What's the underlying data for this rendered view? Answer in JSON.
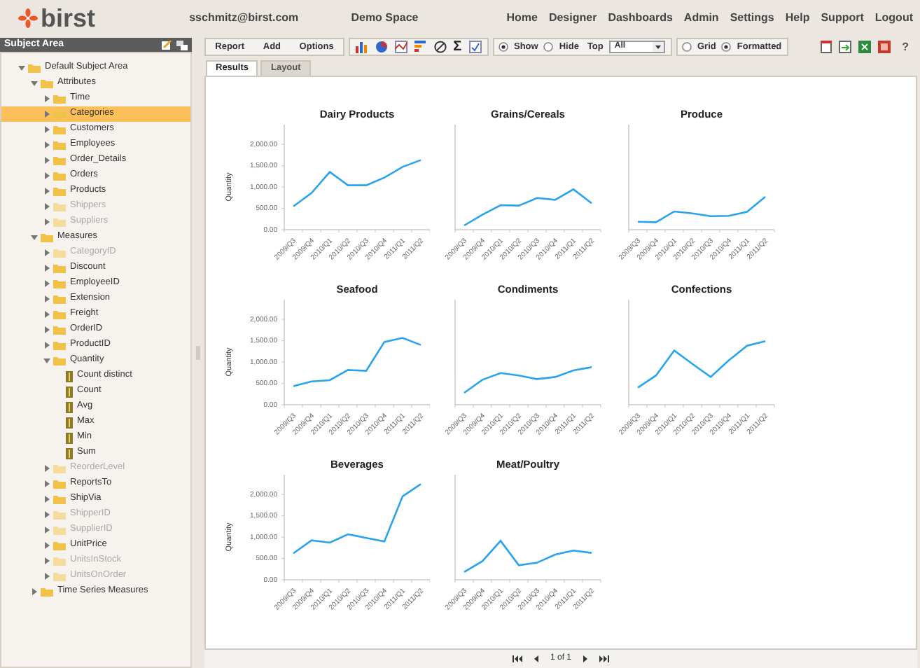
{
  "header": {
    "logo": "birst",
    "user": "sschmitz@birst.com",
    "space": "Demo Space",
    "nav": [
      "Home",
      "Designer",
      "Dashboards",
      "Admin",
      "Settings",
      "Help",
      "Support",
      "Logout"
    ]
  },
  "sidebar": {
    "title": "Subject Area",
    "tree": [
      {
        "label": "Default Subject Area",
        "kind": "folder",
        "expanded": true,
        "selected": false,
        "disabled": false,
        "children": [
          {
            "label": "Attributes",
            "kind": "folder",
            "expanded": true,
            "selected": false,
            "disabled": false,
            "children": [
              {
                "label": "Time",
                "kind": "folder",
                "expanded": false,
                "selected": false,
                "disabled": false
              },
              {
                "label": "Categories",
                "kind": "folder",
                "expanded": false,
                "selected": true,
                "disabled": false
              },
              {
                "label": "Customers",
                "kind": "folder",
                "expanded": false,
                "selected": false,
                "disabled": false
              },
              {
                "label": "Employees",
                "kind": "folder",
                "expanded": false,
                "selected": false,
                "disabled": false
              },
              {
                "label": "Order_Details",
                "kind": "folder",
                "expanded": false,
                "selected": false,
                "disabled": false
              },
              {
                "label": "Orders",
                "kind": "folder",
                "expanded": false,
                "selected": false,
                "disabled": false
              },
              {
                "label": "Products",
                "kind": "folder",
                "expanded": false,
                "selected": false,
                "disabled": false
              },
              {
                "label": "Shippers",
                "kind": "folder",
                "expanded": false,
                "selected": false,
                "disabled": true
              },
              {
                "label": "Suppliers",
                "kind": "folder",
                "expanded": false,
                "selected": false,
                "disabled": true
              }
            ]
          },
          {
            "label": "Measures",
            "kind": "folder",
            "expanded": true,
            "selected": false,
            "disabled": false,
            "children": [
              {
                "label": "CategoryID",
                "kind": "folder",
                "expanded": false,
                "selected": false,
                "disabled": true
              },
              {
                "label": "Discount",
                "kind": "folder",
                "expanded": false,
                "selected": false,
                "disabled": false
              },
              {
                "label": "EmployeeID",
                "kind": "folder",
                "expanded": false,
                "selected": false,
                "disabled": false
              },
              {
                "label": "Extension",
                "kind": "folder",
                "expanded": false,
                "selected": false,
                "disabled": false
              },
              {
                "label": "Freight",
                "kind": "folder",
                "expanded": false,
                "selected": false,
                "disabled": false
              },
              {
                "label": "OrderID",
                "kind": "folder",
                "expanded": false,
                "selected": false,
                "disabled": false
              },
              {
                "label": "ProductID",
                "kind": "folder",
                "expanded": false,
                "selected": false,
                "disabled": false
              },
              {
                "label": "Quantity",
                "kind": "folder",
                "expanded": true,
                "selected": false,
                "disabled": false,
                "children": [
                  {
                    "label": "Count distinct",
                    "kind": "measure",
                    "selected": false,
                    "disabled": false
                  },
                  {
                    "label": "Count",
                    "kind": "measure",
                    "selected": false,
                    "disabled": false
                  },
                  {
                    "label": "Avg",
                    "kind": "measure",
                    "selected": false,
                    "disabled": false
                  },
                  {
                    "label": "Max",
                    "kind": "measure",
                    "selected": false,
                    "disabled": false
                  },
                  {
                    "label": "Min",
                    "kind": "measure",
                    "selected": false,
                    "disabled": false
                  },
                  {
                    "label": "Sum",
                    "kind": "measure",
                    "selected": false,
                    "disabled": false
                  }
                ]
              },
              {
                "label": "ReorderLevel",
                "kind": "folder",
                "expanded": false,
                "selected": false,
                "disabled": true
              },
              {
                "label": "ReportsTo",
                "kind": "folder",
                "expanded": false,
                "selected": false,
                "disabled": false
              },
              {
                "label": "ShipVia",
                "kind": "folder",
                "expanded": false,
                "selected": false,
                "disabled": false
              },
              {
                "label": "ShipperID",
                "kind": "folder",
                "expanded": false,
                "selected": false,
                "disabled": true
              },
              {
                "label": "SupplierID",
                "kind": "folder",
                "expanded": false,
                "selected": false,
                "disabled": true
              },
              {
                "label": "UnitPrice",
                "kind": "folder",
                "expanded": false,
                "selected": false,
                "disabled": false
              },
              {
                "label": "UnitsInStock",
                "kind": "folder",
                "expanded": false,
                "selected": false,
                "disabled": true
              },
              {
                "label": "UnitsOnOrder",
                "kind": "folder",
                "expanded": false,
                "selected": false,
                "disabled": true
              }
            ]
          },
          {
            "label": "Time Series Measures",
            "kind": "folder",
            "expanded": false,
            "selected": false,
            "disabled": false
          }
        ]
      }
    ]
  },
  "toolbar": {
    "menus": [
      "Report",
      "Add",
      "Options"
    ],
    "sigma": "Σ",
    "display": [
      {
        "label": "Show",
        "selected": true
      },
      {
        "label": "Hide",
        "selected": false
      }
    ],
    "top_label": "Top",
    "top_value": "All",
    "view": [
      {
        "label": "Grid",
        "selected": false
      },
      {
        "label": "Formatted",
        "selected": true
      }
    ],
    "help": "?"
  },
  "tabs": [
    {
      "label": "Results",
      "selected": true
    },
    {
      "label": "Layout",
      "selected": false
    }
  ],
  "charts": [
    {
      "chart_data": {
        "type": "line",
        "title": "Dairy Products",
        "ylabel": "Quantity",
        "categories": [
          "2009/Q3",
          "2009/Q4",
          "2010/Q1",
          "2010/Q2",
          "2010/Q3",
          "2010/Q4",
          "2011/Q1",
          "2011/Q2"
        ],
        "series": [
          {
            "color": "#2aa3ee",
            "values": [
              543,
              860,
              1350,
              1040,
              1040,
              1220,
              1470,
              1630
            ]
          }
        ],
        "ylim": [
          0,
          2460
        ],
        "yticks": [
          {
            "value": 0,
            "label": "0.00"
          },
          {
            "value": 500,
            "label": "500.00"
          },
          {
            "value": 1000,
            "label": "1,000.00"
          },
          {
            "value": 1500,
            "label": "1,500.00"
          },
          {
            "value": 2000,
            "label": "2,000.00"
          }
        ]
      }
    },
    {
      "chart_data": {
        "type": "line",
        "title": "Grains/Cereals",
        "categories": [
          "2009/Q3",
          "2009/Q4",
          "2010/Q1",
          "2010/Q2",
          "2010/Q3",
          "2010/Q4",
          "2011/Q1",
          "2011/Q2"
        ],
        "series": [
          {
            "color": "#2aa3ee",
            "values": [
              100,
              350,
              575,
              565,
              740,
              700,
              945,
              620
            ]
          }
        ],
        "ylim": [
          0,
          2460
        ]
      }
    },
    {
      "chart_data": {
        "type": "line",
        "title": "Produce",
        "categories": [
          "2009/Q3",
          "2009/Q4",
          "2010/Q1",
          "2010/Q2",
          "2010/Q3",
          "2010/Q4",
          "2011/Q1",
          "2011/Q2"
        ],
        "series": [
          {
            "color": "#2aa3ee",
            "values": [
              185,
              175,
              425,
              380,
              315,
              325,
              415,
              770
            ]
          }
        ],
        "ylim": [
          0,
          2460
        ]
      }
    },
    {
      "chart_data": {
        "type": "line",
        "title": "Seafood",
        "ylabel": "Quantity",
        "categories": [
          "2009/Q3",
          "2009/Q4",
          "2010/Q1",
          "2010/Q2",
          "2010/Q3",
          "2010/Q4",
          "2011/Q1",
          "2011/Q2"
        ],
        "series": [
          {
            "color": "#2aa3ee",
            "values": [
              435,
              545,
              575,
              815,
              795,
              1470,
              1565,
              1400
            ]
          }
        ],
        "ylim": [
          0,
          2460
        ],
        "yticks": [
          {
            "value": 0,
            "label": "0.00"
          },
          {
            "value": 500,
            "label": "500.00"
          },
          {
            "value": 1000,
            "label": "1,000.00"
          },
          {
            "value": 1500,
            "label": "1,500.00"
          },
          {
            "value": 2000,
            "label": "2,000.00"
          }
        ]
      }
    },
    {
      "chart_data": {
        "type": "line",
        "title": "Condiments",
        "categories": [
          "2009/Q3",
          "2009/Q4",
          "2010/Q1",
          "2010/Q2",
          "2010/Q3",
          "2010/Q4",
          "2011/Q1",
          "2011/Q2"
        ],
        "series": [
          {
            "color": "#2aa3ee",
            "values": [
              280,
              585,
              740,
              685,
              600,
              650,
              805,
              880
            ]
          }
        ],
        "ylim": [
          0,
          2460
        ]
      }
    },
    {
      "chart_data": {
        "type": "line",
        "title": "Confections",
        "categories": [
          "2009/Q3",
          "2009/Q4",
          "2010/Q1",
          "2010/Q2",
          "2010/Q3",
          "2010/Q4",
          "2011/Q1",
          "2011/Q2"
        ],
        "series": [
          {
            "color": "#2aa3ee",
            "values": [
              400,
              685,
              1270,
              955,
              650,
              1040,
              1380,
              1490
            ]
          }
        ],
        "ylim": [
          0,
          2460
        ]
      }
    },
    {
      "chart_data": {
        "type": "line",
        "title": "Beverages",
        "ylabel": "Quantity",
        "categories": [
          "2009/Q3",
          "2009/Q4",
          "2010/Q1",
          "2010/Q2",
          "2010/Q3",
          "2010/Q4",
          "2011/Q1",
          "2011/Q2"
        ],
        "series": [
          {
            "color": "#2aa3ee",
            "values": [
              620,
              925,
              870,
              1065,
              980,
              900,
              1955,
              2240
            ]
          }
        ],
        "ylim": [
          0,
          2460
        ],
        "yticks": [
          {
            "value": 0,
            "label": "0.00"
          },
          {
            "value": 500,
            "label": "500.00"
          },
          {
            "value": 1000,
            "label": "1,000.00"
          },
          {
            "value": 1500,
            "label": "1,500.00"
          },
          {
            "value": 2000,
            "label": "2,000.00"
          }
        ]
      }
    },
    {
      "chart_data": {
        "type": "line",
        "title": "Meat/Poultry",
        "categories": [
          "2009/Q3",
          "2009/Q4",
          "2010/Q1",
          "2010/Q2",
          "2010/Q3",
          "2010/Q4",
          "2011/Q1",
          "2011/Q2"
        ],
        "series": [
          {
            "color": "#2aa3ee",
            "values": [
              185,
              435,
              913,
              337,
              400,
              590,
              685,
              630
            ]
          }
        ],
        "ylim": [
          0,
          2460
        ]
      }
    }
  ],
  "pager": {
    "text": "1 of 1"
  }
}
